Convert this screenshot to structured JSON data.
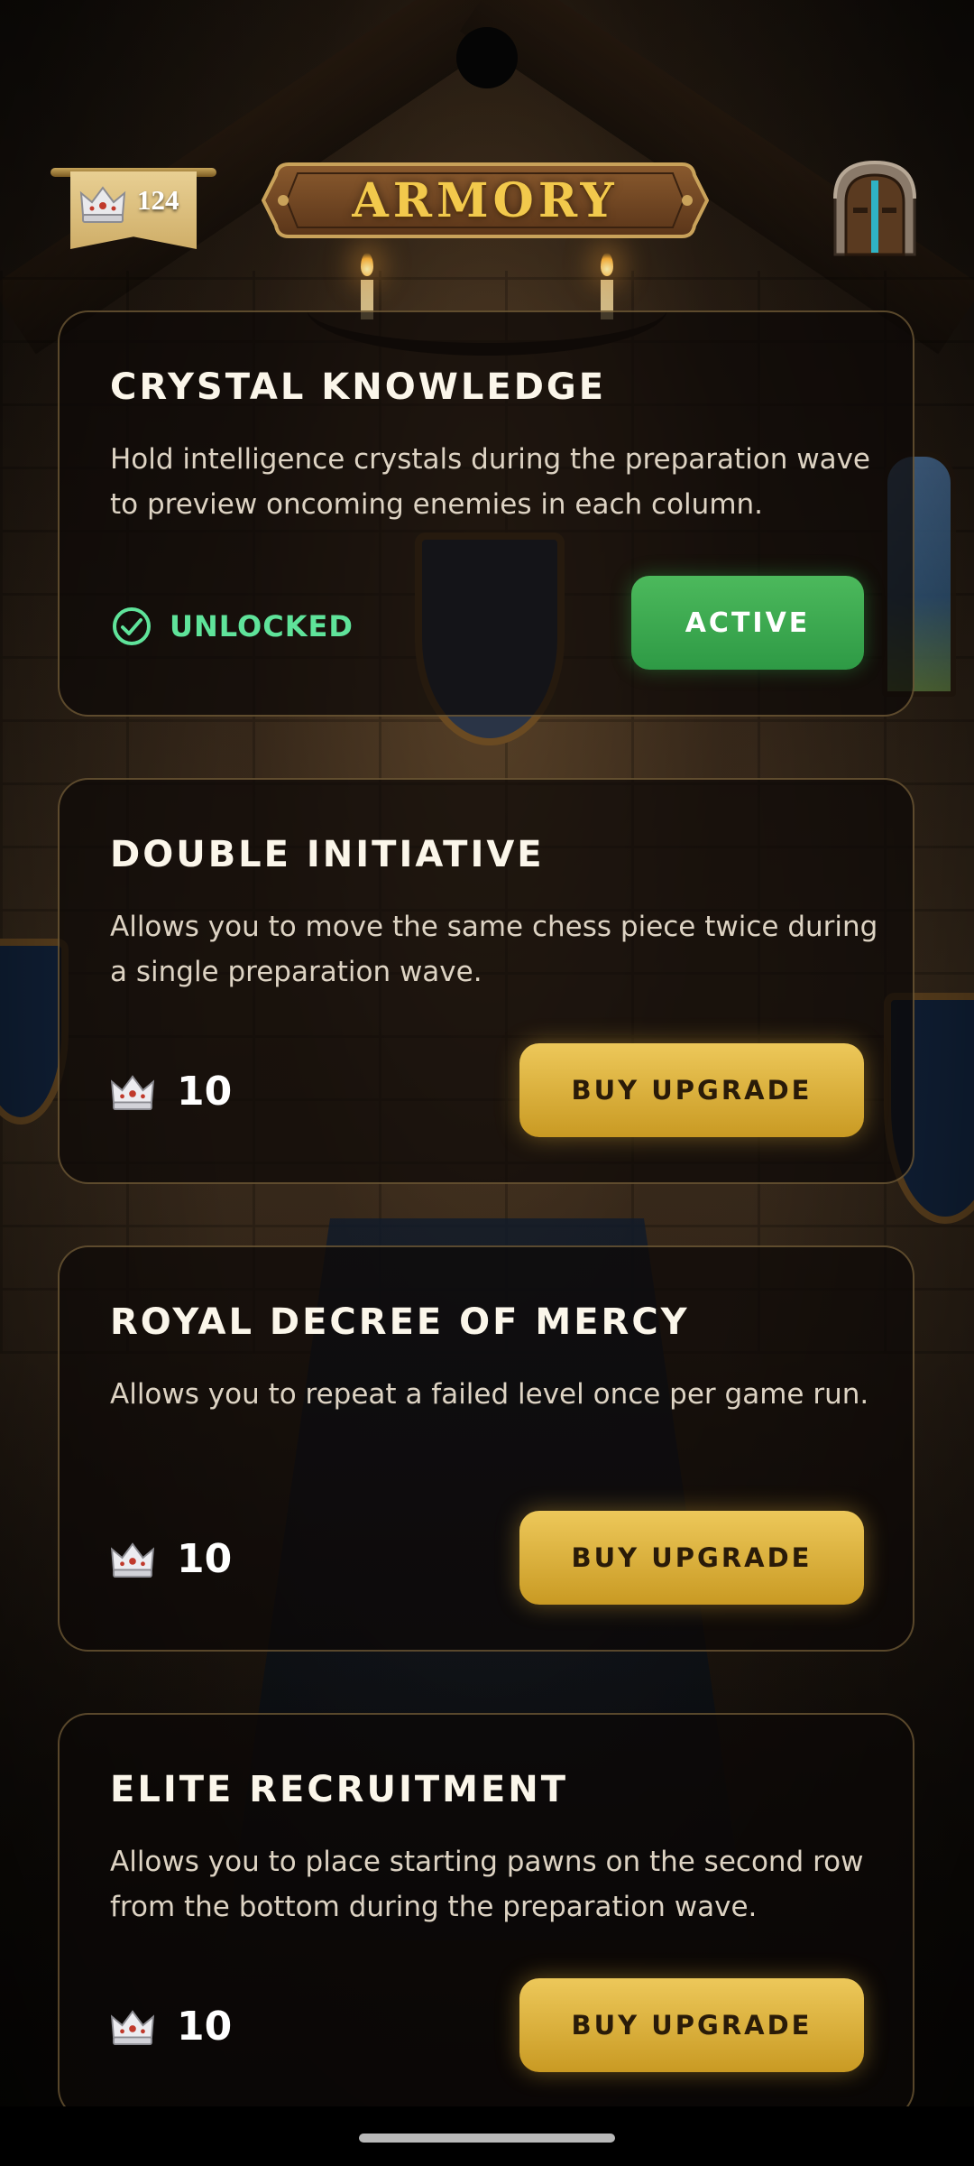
{
  "header": {
    "crowns_count": "124",
    "title": "ARMORY",
    "crown_icon": "crown-icon",
    "exit_icon": "castle-door-icon"
  },
  "upgrades": [
    {
      "title": "CRYSTAL KNOWLEDGE",
      "description": "Hold intelligence crystals during the preparation wave to preview oncoming enemies in each column.",
      "status_label": "UNLOCKED",
      "button_label": "ACTIVE"
    },
    {
      "title": "DOUBLE INITIATIVE",
      "description": "Allows you to move the same chess piece twice during a single preparation wave.",
      "price": "10",
      "button_label": "BUY UPGRADE"
    },
    {
      "title": "ROYAL DECREE OF MERCY",
      "description": "Allows you to repeat a failed level once per game run.",
      "price": "10",
      "button_label": "BUY UPGRADE"
    },
    {
      "title": "ELITE RECRUITMENT",
      "description": "Allows you to place starting pawns on the second row from the bottom during the preparation wave.",
      "price": "10",
      "button_label": "BUY UPGRADE"
    }
  ],
  "colors": {
    "accent_gold": "#e8c04f",
    "active_green": "#3aa84f",
    "unlocked_text": "#5fe39a",
    "card_border": "#c4a060"
  }
}
